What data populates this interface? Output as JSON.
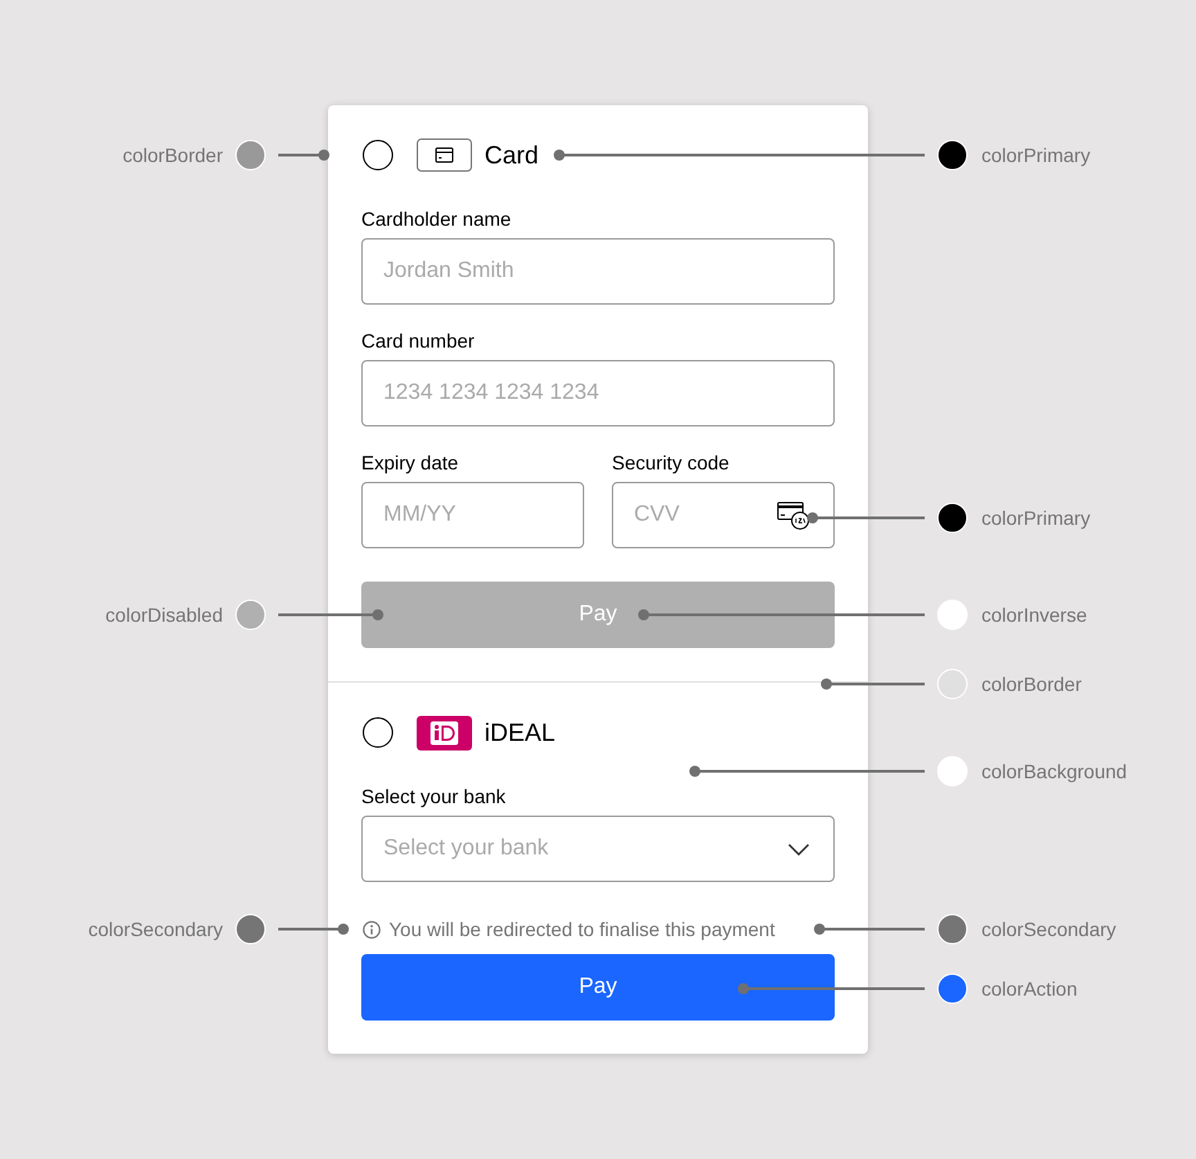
{
  "payment_methods": [
    {
      "kind": "card",
      "selected": false,
      "title": "Card",
      "field_rows": [
        [
          {
            "kind": "text",
            "label": "Cardholder name",
            "placeholder": "Jordan Smith"
          }
        ],
        [
          {
            "kind": "text",
            "label": "Card number",
            "placeholder": "1234 1234 1234 1234"
          }
        ],
        [
          {
            "kind": "text",
            "label": "Expiry date",
            "placeholder": "MM/YY"
          },
          {
            "kind": "cvv",
            "label": "Security code",
            "placeholder": "CVV"
          }
        ]
      ],
      "button": {
        "label": "Pay",
        "disabled": true
      }
    },
    {
      "kind": "ideal",
      "selected": false,
      "title": "iDEAL",
      "field_rows": [
        [
          {
            "kind": "select",
            "label": "Select your bank",
            "placeholder": "Select your bank"
          }
        ]
      ],
      "notice": "You will be redirected to finalise this payment",
      "button": {
        "label": "Pay",
        "disabled": false
      }
    }
  ],
  "annotations_left": [
    {
      "label": "colorBorder",
      "color": "#999999"
    },
    {
      "label": "colorDisabled",
      "color": "#b0b0b0"
    },
    {
      "label": "colorSecondary",
      "color": "#757575"
    }
  ],
  "annotations_right": [
    {
      "label": "colorPrimary",
      "color": "#000000"
    },
    {
      "label": "colorPrimary",
      "color": "#000000"
    },
    {
      "label": "colorInverse",
      "color": "#ffffff"
    },
    {
      "label": "colorBorder",
      "color": "#e0e0e0"
    },
    {
      "label": "colorBackground",
      "color": "#ffffff"
    },
    {
      "label": "colorSecondary",
      "color": "#757575"
    },
    {
      "label": "colorAction",
      "color": "#1a66ff"
    }
  ]
}
